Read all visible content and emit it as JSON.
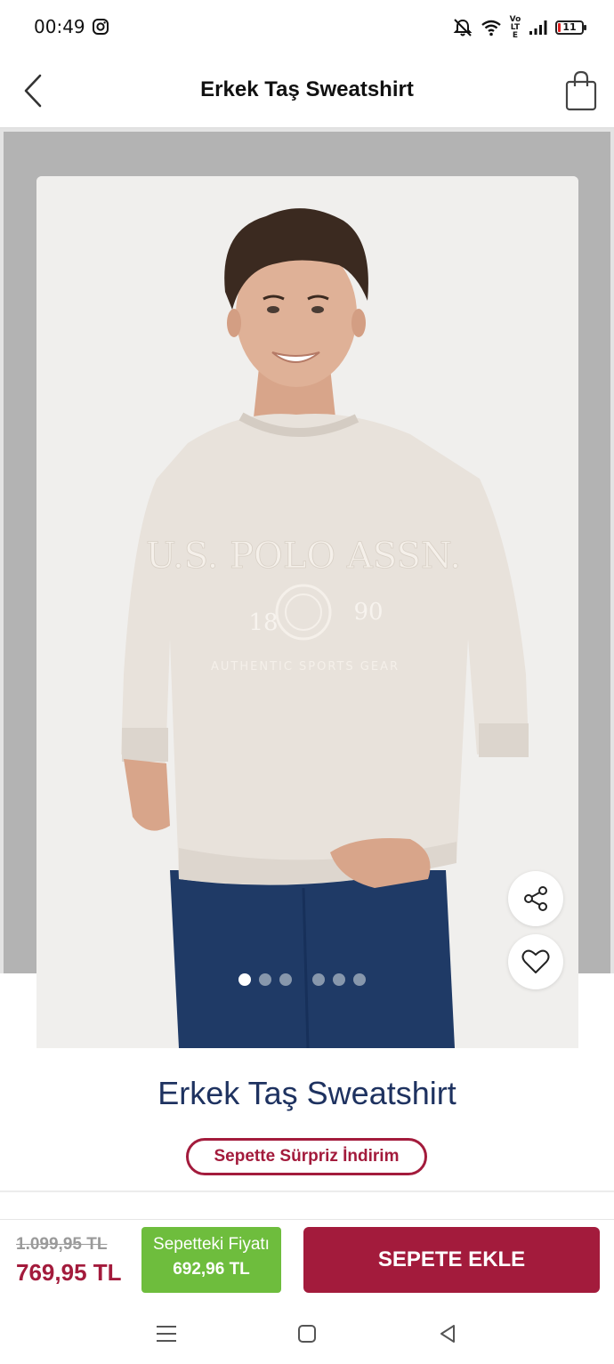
{
  "status_bar": {
    "time": "00:49",
    "network": "Vo LTE",
    "battery_level": "11",
    "battery_color": "#e02020",
    "icons": [
      "instagram-icon",
      "mute-icon",
      "wifi-icon",
      "signal-icon",
      "battery-icon"
    ]
  },
  "header": {
    "title": "Erkek Taş Sweatshirt",
    "back_icon": "chevron-left-icon",
    "cart_icon": "shopping-bag-icon"
  },
  "gallery": {
    "image_count": 6,
    "active_index": 0,
    "print_line1": "U.S. POLO ASSN.",
    "print_year_left": "18",
    "print_year_right": "90",
    "print_line2": "AUTHENTIC SPORTS GEAR"
  },
  "actions": {
    "share_icon": "share-icon",
    "favorite_icon": "heart-icon"
  },
  "product": {
    "name": "Erkek Taş Sweatshirt",
    "promo_label": "Sepette Sürpriz İndirim"
  },
  "pricing": {
    "old_price": "1.099,95 TL",
    "current_price": "769,95 TL",
    "basket_price_label": "Sepetteki Fiyatı",
    "basket_price_value": "692,96 TL"
  },
  "cart_button": {
    "label": "SEPETE EKLE"
  },
  "colors": {
    "brand_red": "#a31b3c",
    "navy": "#1e3260",
    "basket_green": "#6ebd3d"
  },
  "nav": {
    "icons": [
      "menu-icon",
      "home-icon",
      "back-icon"
    ]
  }
}
